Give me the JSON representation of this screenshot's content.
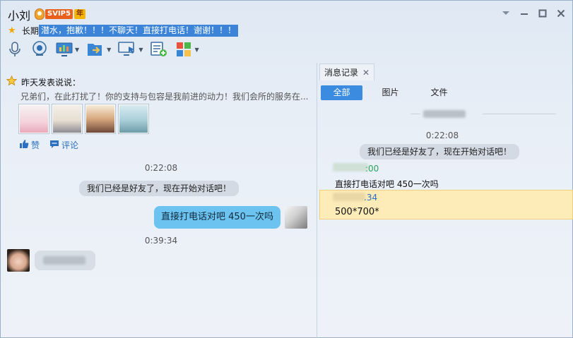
{
  "header": {
    "contact_name": "小刘",
    "vip_label": "SVIP5",
    "year_label": "年",
    "status_label": "长期",
    "status_text": "潜水，抱歉！！！不聊天！直接打电话！谢谢！！！"
  },
  "window_buttons": [
    "chevron-down-icon",
    "minimize-icon",
    "maximize-icon",
    "close-icon"
  ],
  "toolbar": {
    "items": [
      "microphone-icon",
      "video-icon",
      "screen-share-icon",
      "file-transfer-icon",
      "remote-desktop-icon",
      "new-note-icon",
      "apps-icon"
    ]
  },
  "moment": {
    "title": "昨天发表说说：",
    "body": "兄弟们，在此打扰了！你的支持与包容是我前进的动力！我们会所的服务在...",
    "like_label": "赞",
    "comment_label": "评论"
  },
  "chat": {
    "time1": "0:22:08",
    "system_msg": "我们已经是好友了，现在开始对话吧！",
    "outgoing_msg": "直接打电话对吧 450一次吗",
    "time2": "0:39:34"
  },
  "history": {
    "tab_label": "消息记录",
    "filters": [
      "全部",
      "图片",
      "文件"
    ],
    "time1": "0:22:08",
    "system_msg": "我们已经是好友了，现在开始对话吧！",
    "entry1_time_partial": ":00",
    "entry1_msg": "直接打电话对吧 450一次吗",
    "entry2_time_partial": ".34",
    "entry2_msg": "500*700*"
  },
  "colors": {
    "accent": "#3b8be0",
    "outgoing_bubble": "#6cc3f0",
    "highlight_row": "#fdebb8",
    "status_highlight": "#3b84d8"
  }
}
